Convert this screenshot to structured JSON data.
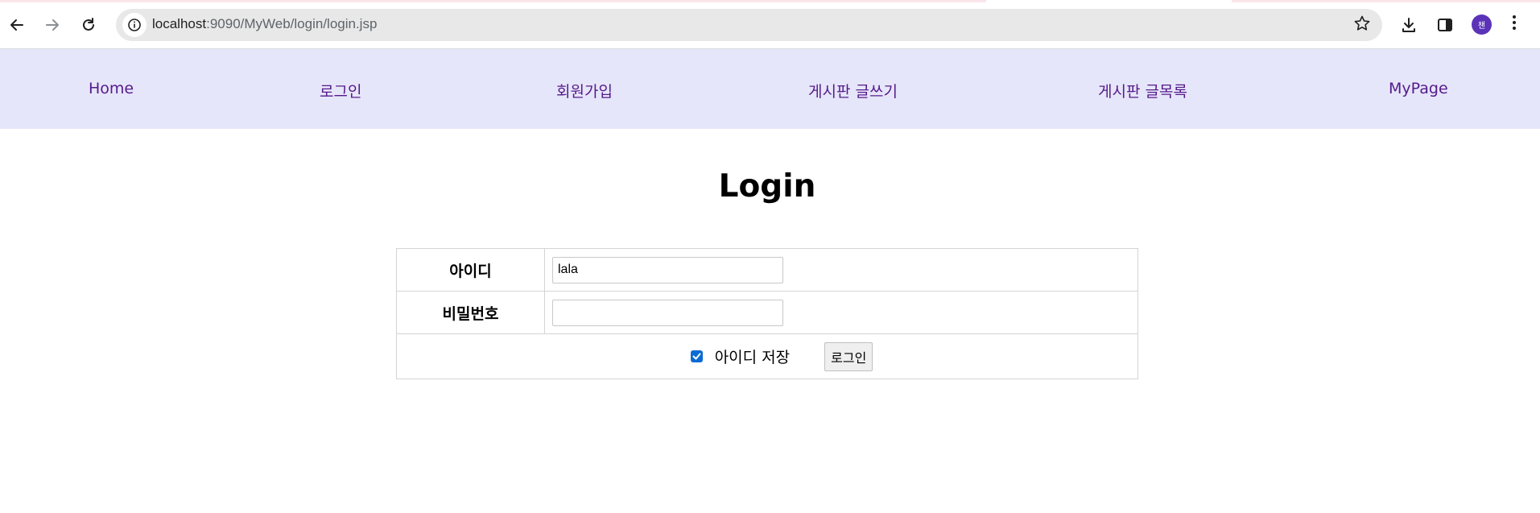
{
  "browser": {
    "url_host": "localhost",
    "url_path": ":9090/MyWeb/login/login.jsp",
    "profile_initial": "챈"
  },
  "nav": {
    "items": [
      {
        "label": "Home"
      },
      {
        "label": "로그인"
      },
      {
        "label": "회원가입"
      },
      {
        "label": "게시판 글쓰기"
      },
      {
        "label": "게시판 글목록"
      },
      {
        "label": "MyPage"
      }
    ],
    "background": "#e6e6fa",
    "link_color": "#551a8b"
  },
  "main": {
    "title": "Login",
    "form": {
      "id_label": "아이디",
      "id_value": "lala",
      "password_label": "비밀번호",
      "password_value": "",
      "remember_label": "아이디 저장",
      "remember_checked": true,
      "submit_label": "로그인"
    }
  },
  "icons": [
    "back-arrow-icon",
    "forward-arrow-icon",
    "reload-icon",
    "info-icon",
    "star-icon",
    "download-icon",
    "side-panel-icon",
    "more-vert-icon"
  ]
}
